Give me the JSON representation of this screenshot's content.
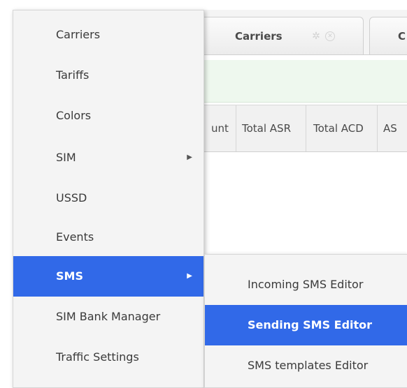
{
  "tabs": [
    {
      "label": "Carriers"
    },
    {
      "label": "C"
    }
  ],
  "tab_icons": {
    "settings": "gear-icon",
    "close": "close-icon"
  },
  "table": {
    "columns": [
      "unt",
      "Total ASR",
      "Total ACD",
      "AS"
    ]
  },
  "menu": {
    "items": [
      {
        "label": "Carriers",
        "has_submenu": false
      },
      {
        "label": "Tariffs",
        "has_submenu": false
      },
      {
        "label": "Colors",
        "has_submenu": false
      },
      {
        "label": "SIM",
        "has_submenu": true
      },
      {
        "label": "USSD",
        "has_submenu": false
      },
      {
        "label": "Events",
        "has_submenu": false
      },
      {
        "label": "SMS",
        "has_submenu": true,
        "active": true
      },
      {
        "label": "SIM Bank Manager",
        "has_submenu": false
      },
      {
        "label": "Traffic Settings",
        "has_submenu": false
      }
    ],
    "arrow_glyph": "▶"
  },
  "submenu": {
    "items": [
      {
        "label": "Incoming SMS Editor"
      },
      {
        "label": "Sending SMS Editor",
        "active": true
      },
      {
        "label": "SMS templates Editor"
      }
    ]
  },
  "colors": {
    "highlight": "#3169e8",
    "menu_bg": "#f4f4f4",
    "frame_border": "#f0a030"
  }
}
